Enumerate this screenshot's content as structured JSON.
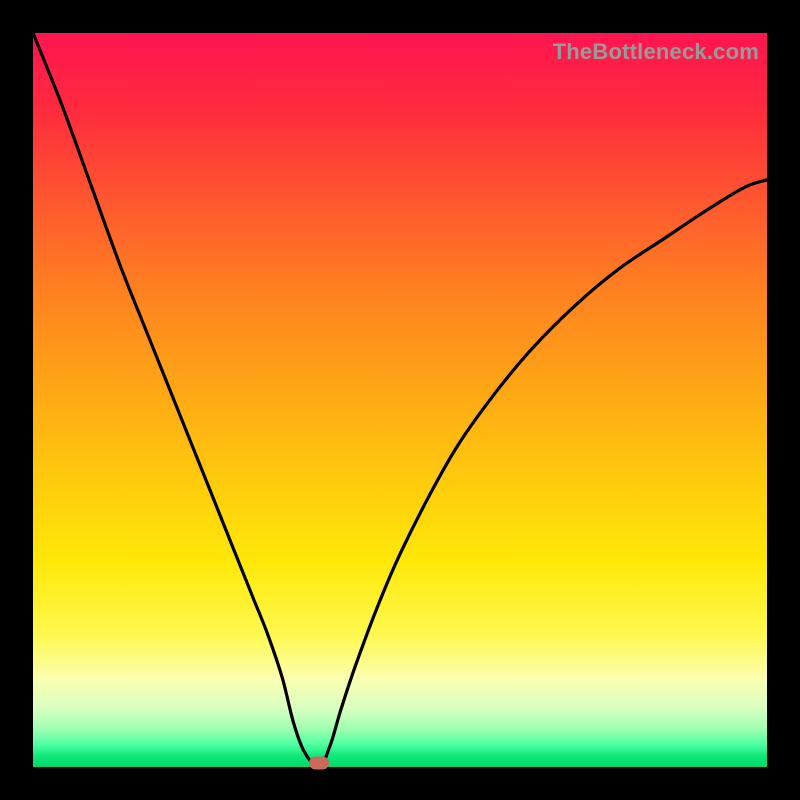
{
  "watermark": "TheBottleneck.com",
  "colors": {
    "frame": "#000000",
    "curve": "#000000",
    "marker": "#c96a5d",
    "gradient_top": "#ff1450",
    "gradient_bottom": "#00d868"
  },
  "chart_data": {
    "type": "line",
    "title": "",
    "xlabel": "",
    "ylabel": "",
    "xlim": [
      0,
      100
    ],
    "ylim": [
      0,
      100
    ],
    "grid": false,
    "legend": false,
    "marker": {
      "x": 39,
      "y": 0
    },
    "series": [
      {
        "name": "curve",
        "x": [
          0,
          4,
          8,
          12,
          16,
          20,
          24,
          28,
          30,
          32,
          34,
          35.5,
          37,
          39,
          40.5,
          42,
          44,
          47,
          50,
          54,
          58,
          63,
          68,
          74,
          80,
          86,
          92,
          97,
          100
        ],
        "values": [
          100,
          90,
          79,
          68,
          58,
          48,
          38,
          28,
          23,
          18,
          12,
          6,
          2,
          0,
          3,
          8,
          14,
          22,
          29,
          37,
          44,
          51,
          57,
          63,
          68,
          72,
          76,
          79,
          80
        ]
      }
    ]
  }
}
